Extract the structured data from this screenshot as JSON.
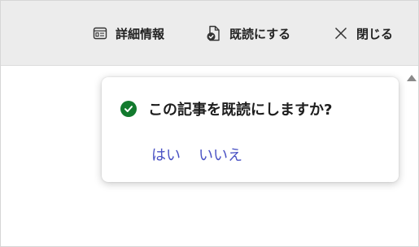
{
  "toolbar": {
    "details": {
      "label": "詳細情報",
      "icon": "details-icon"
    },
    "mark_read": {
      "label": "既読にする",
      "icon": "document-check-icon"
    },
    "close": {
      "label": "閉じる",
      "icon": "close-icon"
    }
  },
  "dialog": {
    "message": "この記事を既読にしますか?",
    "status_icon": "check-circle-icon",
    "yes_label": "はい",
    "no_label": "いいえ"
  },
  "colors": {
    "toolbar_bg": "#ececec",
    "check_green": "#127a2d",
    "link_blue": "#4a52c4"
  }
}
